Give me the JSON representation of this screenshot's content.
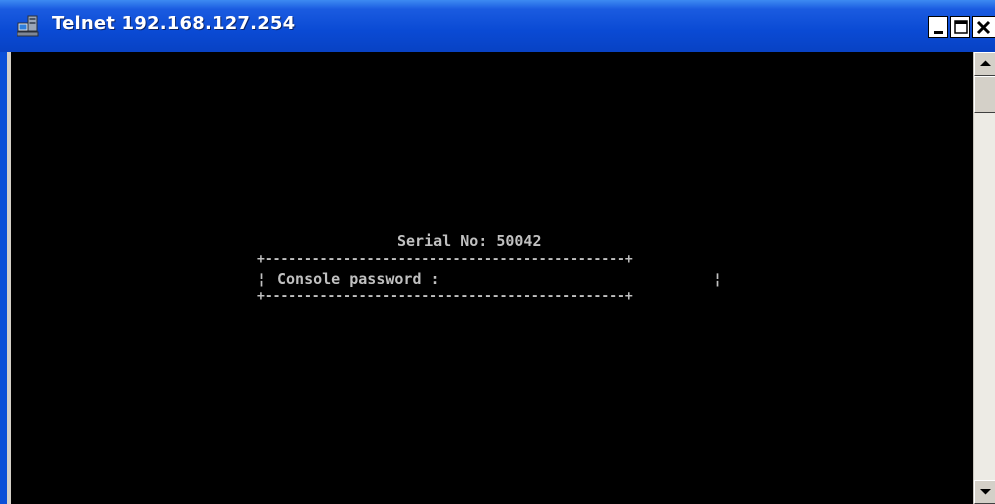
{
  "window": {
    "title": "Telnet 192.168.127.254",
    "icon": "telnet-computer-icon",
    "controls": [
      "minimize-icon",
      "maximize-icon",
      "close-icon"
    ]
  },
  "console": {
    "serial_label": "Serial No: 50042",
    "border_top": "+----------------------------------------------+",
    "border_bottom": "+----------------------------------------------+",
    "border_side": "¦",
    "password_prompt": "Console password :"
  },
  "scrollbar": {
    "up_icon": "scroll-up-arrow-icon",
    "down_icon": "scroll-down-arrow-icon"
  },
  "colors": {
    "titlebar": "#0A4AD4",
    "console_bg": "#000000",
    "console_text": "#C0C0C0"
  }
}
